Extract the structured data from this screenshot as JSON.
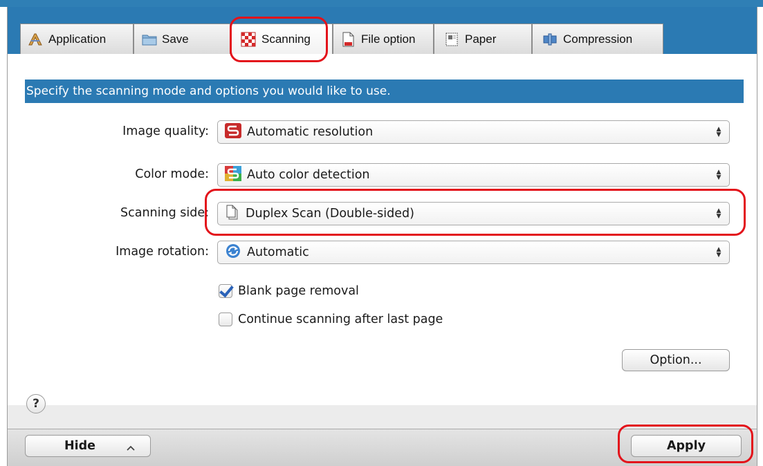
{
  "tabs": [
    {
      "label": "Application",
      "icon": "application-icon",
      "active": false
    },
    {
      "label": "Save",
      "icon": "folder-icon",
      "active": false
    },
    {
      "label": "Scanning",
      "icon": "checkerboard-icon",
      "active": true
    },
    {
      "label": "File option",
      "icon": "document-icon",
      "active": false
    },
    {
      "label": "Paper",
      "icon": "paper-icon",
      "active": false
    },
    {
      "label": "Compression",
      "icon": "compression-icon",
      "active": false
    }
  ],
  "header": "Specify the scanning mode and options you would like to use.",
  "settings": {
    "image_quality": {
      "label": "Image quality:",
      "value": "Automatic resolution",
      "icon": "scansnap-red-icon"
    },
    "color_mode": {
      "label": "Color mode:",
      "value": "Auto color detection",
      "icon": "scansnap-color-icon"
    },
    "scanning_side": {
      "label": "Scanning side:",
      "value": "Duplex Scan (Double-sided)",
      "icon": "duplex-page-icon"
    },
    "image_rotation": {
      "label": "Image rotation:",
      "value": "Automatic",
      "icon": "rotate-icon"
    }
  },
  "options": {
    "blank_page_removal": {
      "label": "Blank page removal",
      "checked": true
    },
    "continue_scanning": {
      "label": "Continue scanning after last page",
      "checked": false
    }
  },
  "buttons": {
    "option": "Option...",
    "hide": "Hide",
    "apply": "Apply",
    "help": "?"
  },
  "colors": {
    "accent_blue": "#2b7ab3",
    "annotation_red": "#e3131b"
  }
}
